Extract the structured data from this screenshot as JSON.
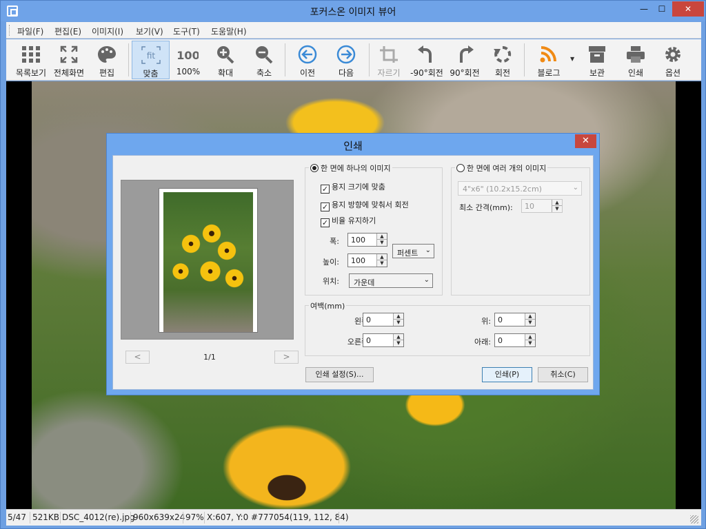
{
  "window": {
    "title": "포커스온 이미지 뷰어",
    "min": "—",
    "max": "☐",
    "close": "✕"
  },
  "menu": [
    "파일(F)",
    "편집(E)",
    "이미지(I)",
    "보기(V)",
    "도구(T)",
    "도움말(H)"
  ],
  "toolbar": {
    "list": "목록보기",
    "fullscreen": "전체화면",
    "edit": "편집",
    "fit": "맞춤",
    "actual": "100%",
    "actual_icon_text": "100",
    "fit_icon_text": "fit",
    "zoomin": "확대",
    "zoomout": "축소",
    "prev": "이전",
    "next": "다음",
    "crop": "자르기",
    "rotl": "-90°회전",
    "rotr": "90°회전",
    "rotate": "회전",
    "blog": "블로그",
    "archive": "보관",
    "print": "인쇄",
    "options": "옵션"
  },
  "status": {
    "index": "5/47",
    "size": "521KB",
    "file": "DSC_4012(re).jpg",
    "dims": "960x639x24",
    "zoom": "97%",
    "pixel": "X:607, Y:0 #777054(119, 112, 84)"
  },
  "dialog": {
    "title": "인쇄",
    "close": "✕",
    "page_indicator": "1/1",
    "prev": "<",
    "next": ">",
    "single": {
      "label": "한 면에 하나의 이미지",
      "fit_paper": "용지 크기에 맞춤",
      "rotate_paper": "용지 방향에 맞춰서 회전",
      "keep_ratio": "비율 유지하기",
      "width_label": "폭:",
      "width": "100",
      "height_label": "높이:",
      "height": "100",
      "unit": "퍼센트",
      "position_label": "위치:",
      "position": "가운데"
    },
    "multi": {
      "label": "한 면에 여러 개의 이미지",
      "size": "4\"x6\" (10.2x15.2cm)",
      "gap_label": "최소 간격(mm):",
      "gap": "10"
    },
    "margin": {
      "label": "여백(mm)",
      "left_label": "왼쪽:",
      "left": "0",
      "right_label": "오른쪽:",
      "right": "0",
      "top_label": "위:",
      "top": "0",
      "bottom_label": "아래:",
      "bottom": "0"
    },
    "settings_btn": "인쇄 설정(S)...",
    "print_btn": "인쇄(P)",
    "cancel_btn": "취소(C)"
  }
}
